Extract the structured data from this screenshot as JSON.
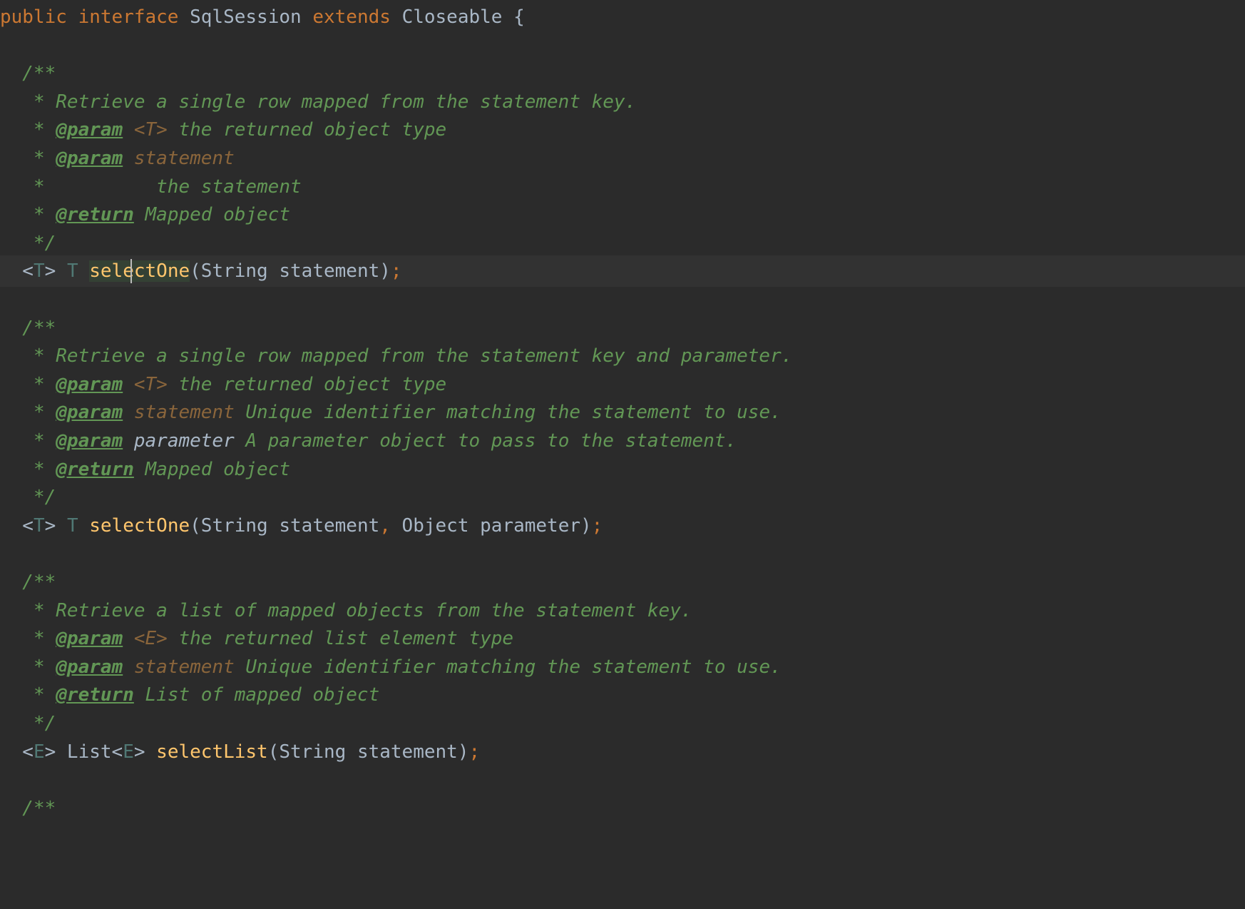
{
  "editor": {
    "language": "java",
    "caret": {
      "line": 9,
      "column": 13
    },
    "colors": {
      "background": "#2b2b2b",
      "current_line": "#323232",
      "keyword": "#cc7832",
      "identifier": "#a9b7c6",
      "method_declaration": "#ffc66d",
      "type_parameter": "#507874",
      "doc_comment": "#629755",
      "doc_param_name": "#8a653b"
    },
    "lines": [
      {
        "tokens": [
          {
            "text": "public",
            "kind": "kw"
          },
          {
            "text": " ",
            "kind": "plain"
          },
          {
            "text": "interface",
            "kind": "kw"
          },
          {
            "text": " ",
            "kind": "plain"
          },
          {
            "text": "SqlSession",
            "kind": "plain"
          },
          {
            "text": " ",
            "kind": "plain"
          },
          {
            "text": "extends",
            "kind": "kw"
          },
          {
            "text": " ",
            "kind": "plain"
          },
          {
            "text": "Closeable",
            "kind": "plain"
          },
          {
            "text": " {",
            "kind": "plain"
          }
        ]
      },
      {
        "tokens": []
      },
      {
        "tokens": [
          {
            "text": "  /**",
            "kind": "doc"
          }
        ]
      },
      {
        "tokens": [
          {
            "text": "   * Retrieve a single row mapped from the statement key.",
            "kind": "doc"
          }
        ]
      },
      {
        "tokens": [
          {
            "text": "   * ",
            "kind": "doc"
          },
          {
            "text": "@param",
            "kind": "tag"
          },
          {
            "text": " ",
            "kind": "doc"
          },
          {
            "text": "<T>",
            "kind": "docparam"
          },
          {
            "text": " the returned object type",
            "kind": "doc"
          }
        ]
      },
      {
        "tokens": [
          {
            "text": "   * ",
            "kind": "doc"
          },
          {
            "text": "@param",
            "kind": "tag"
          },
          {
            "text": " ",
            "kind": "doc"
          },
          {
            "text": "statement",
            "kind": "docparam"
          }
        ]
      },
      {
        "tokens": [
          {
            "text": "   *          the statement",
            "kind": "doc"
          }
        ]
      },
      {
        "tokens": [
          {
            "text": "   * ",
            "kind": "doc"
          },
          {
            "text": "@return",
            "kind": "tag"
          },
          {
            "text": " Mapped object",
            "kind": "doc"
          }
        ]
      },
      {
        "tokens": [
          {
            "text": "   */",
            "kind": "doc"
          }
        ]
      },
      {
        "current": true,
        "tokens": [
          {
            "text": "  <",
            "kind": "plain"
          },
          {
            "text": "T",
            "kind": "tparam"
          },
          {
            "text": "> ",
            "kind": "plain"
          },
          {
            "text": "T",
            "kind": "tparam"
          },
          {
            "text": " ",
            "kind": "plain"
          },
          {
            "text": "selectOne",
            "kind": "method",
            "highlight": true
          },
          {
            "text": "(String statement)",
            "kind": "plain"
          },
          {
            "text": ";",
            "kind": "punct"
          }
        ]
      },
      {
        "tokens": []
      },
      {
        "tokens": [
          {
            "text": "  /**",
            "kind": "doc"
          }
        ]
      },
      {
        "tokens": [
          {
            "text": "   * Retrieve a single row mapped from the statement key and parameter.",
            "kind": "doc"
          }
        ]
      },
      {
        "tokens": [
          {
            "text": "   * ",
            "kind": "doc"
          },
          {
            "text": "@param",
            "kind": "tag"
          },
          {
            "text": " ",
            "kind": "doc"
          },
          {
            "text": "<T>",
            "kind": "docparam"
          },
          {
            "text": " the returned object type",
            "kind": "doc"
          }
        ]
      },
      {
        "tokens": [
          {
            "text": "   * ",
            "kind": "doc"
          },
          {
            "text": "@param",
            "kind": "tag"
          },
          {
            "text": " ",
            "kind": "doc"
          },
          {
            "text": "statement",
            "kind": "docparam"
          },
          {
            "text": " Unique identifier matching the statement to use.",
            "kind": "doc"
          }
        ]
      },
      {
        "tokens": [
          {
            "text": "   * ",
            "kind": "doc"
          },
          {
            "text": "@param",
            "kind": "tag"
          },
          {
            "text": " ",
            "kind": "doc"
          },
          {
            "text": "parameter",
            "kind": "docref"
          },
          {
            "text": " A parameter object to pass to the statement.",
            "kind": "doc"
          }
        ]
      },
      {
        "tokens": [
          {
            "text": "   * ",
            "kind": "doc"
          },
          {
            "text": "@return",
            "kind": "tag"
          },
          {
            "text": " Mapped object",
            "kind": "doc"
          }
        ]
      },
      {
        "tokens": [
          {
            "text": "   */",
            "kind": "doc"
          }
        ]
      },
      {
        "tokens": [
          {
            "text": "  <",
            "kind": "plain"
          },
          {
            "text": "T",
            "kind": "tparam"
          },
          {
            "text": "> ",
            "kind": "plain"
          },
          {
            "text": "T",
            "kind": "tparam"
          },
          {
            "text": " ",
            "kind": "plain"
          },
          {
            "text": "selectOne",
            "kind": "method"
          },
          {
            "text": "(String statement",
            "kind": "plain"
          },
          {
            "text": ",",
            "kind": "punct"
          },
          {
            "text": " Object parameter)",
            "kind": "plain"
          },
          {
            "text": ";",
            "kind": "punct"
          }
        ]
      },
      {
        "tokens": []
      },
      {
        "tokens": [
          {
            "text": "  /**",
            "kind": "doc"
          }
        ]
      },
      {
        "tokens": [
          {
            "text": "   * Retrieve a list of mapped objects from the statement key.",
            "kind": "doc"
          }
        ]
      },
      {
        "tokens": [
          {
            "text": "   * ",
            "kind": "doc"
          },
          {
            "text": "@param",
            "kind": "tag"
          },
          {
            "text": " ",
            "kind": "doc"
          },
          {
            "text": "<E>",
            "kind": "docparam"
          },
          {
            "text": " the returned list element type",
            "kind": "doc"
          }
        ]
      },
      {
        "tokens": [
          {
            "text": "   * ",
            "kind": "doc"
          },
          {
            "text": "@param",
            "kind": "tag"
          },
          {
            "text": " ",
            "kind": "doc"
          },
          {
            "text": "statement",
            "kind": "docparam"
          },
          {
            "text": " Unique identifier matching the statement to use.",
            "kind": "doc"
          }
        ]
      },
      {
        "tokens": [
          {
            "text": "   * ",
            "kind": "doc"
          },
          {
            "text": "@return",
            "kind": "tag"
          },
          {
            "text": " List of mapped object",
            "kind": "doc"
          }
        ]
      },
      {
        "tokens": [
          {
            "text": "   */",
            "kind": "doc"
          }
        ]
      },
      {
        "tokens": [
          {
            "text": "  <",
            "kind": "plain"
          },
          {
            "text": "E",
            "kind": "tparam"
          },
          {
            "text": "> List<",
            "kind": "plain"
          },
          {
            "text": "E",
            "kind": "tparam"
          },
          {
            "text": "> ",
            "kind": "plain"
          },
          {
            "text": "selectList",
            "kind": "method"
          },
          {
            "text": "(String statement)",
            "kind": "plain"
          },
          {
            "text": ";",
            "kind": "punct"
          }
        ]
      },
      {
        "tokens": []
      },
      {
        "tokens": [
          {
            "text": "  /**",
            "kind": "doc"
          }
        ]
      }
    ]
  }
}
